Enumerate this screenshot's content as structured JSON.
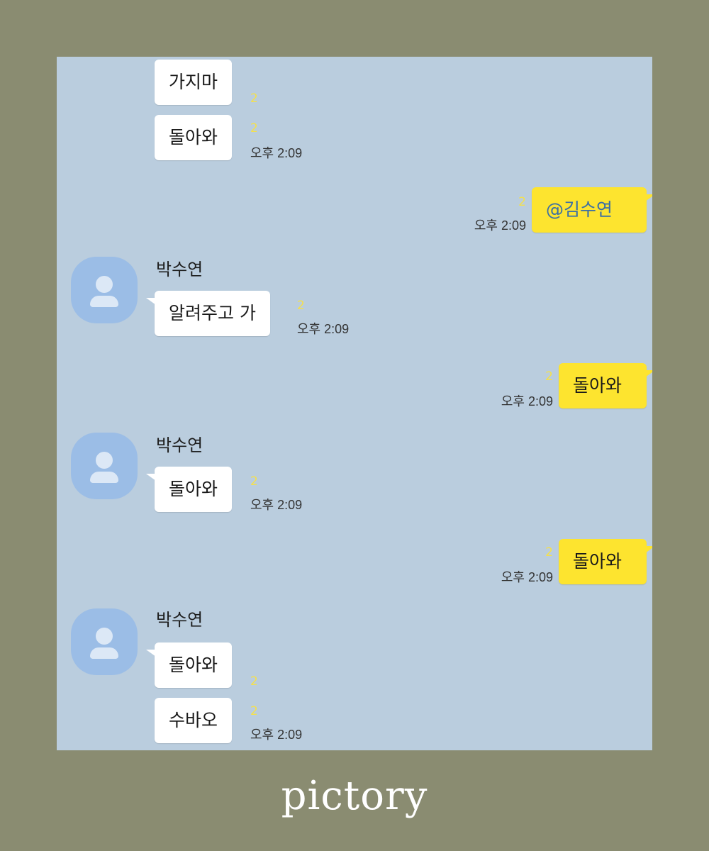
{
  "chat": {
    "messages": [
      {
        "text": "가지마",
        "unread": "2"
      },
      {
        "text": "돌아와",
        "unread": "2",
        "time": "오후 2:09"
      },
      {
        "text": "@김수연",
        "unread": "2",
        "time": "오후 2:09"
      },
      {
        "sender": "박수연",
        "text": "알려주고 가",
        "unread": "2",
        "time": "오후 2:09"
      },
      {
        "text": "돌아와",
        "unread": "2",
        "time": "오후 2:09"
      },
      {
        "sender": "박수연",
        "text": "돌아와",
        "unread": "2",
        "time": "오후 2:09"
      },
      {
        "text": "돌아와",
        "unread": "2",
        "time": "오후 2:09"
      },
      {
        "sender": "박수연",
        "text": "돌아와",
        "unread": "2"
      },
      {
        "text": "수바오",
        "unread": "2",
        "time": "오후 2:09"
      }
    ]
  },
  "brand": {
    "text": "pictory"
  },
  "colors": {
    "outer_background": "#8a8c71",
    "chat_background": "#bacdde",
    "incoming_bubble": "#ffffff",
    "outgoing_bubble": "#fde42f",
    "unread_count": "#f4e04d",
    "avatar": "#9bbde6"
  },
  "icons": {
    "avatar": "default-profile-icon"
  }
}
